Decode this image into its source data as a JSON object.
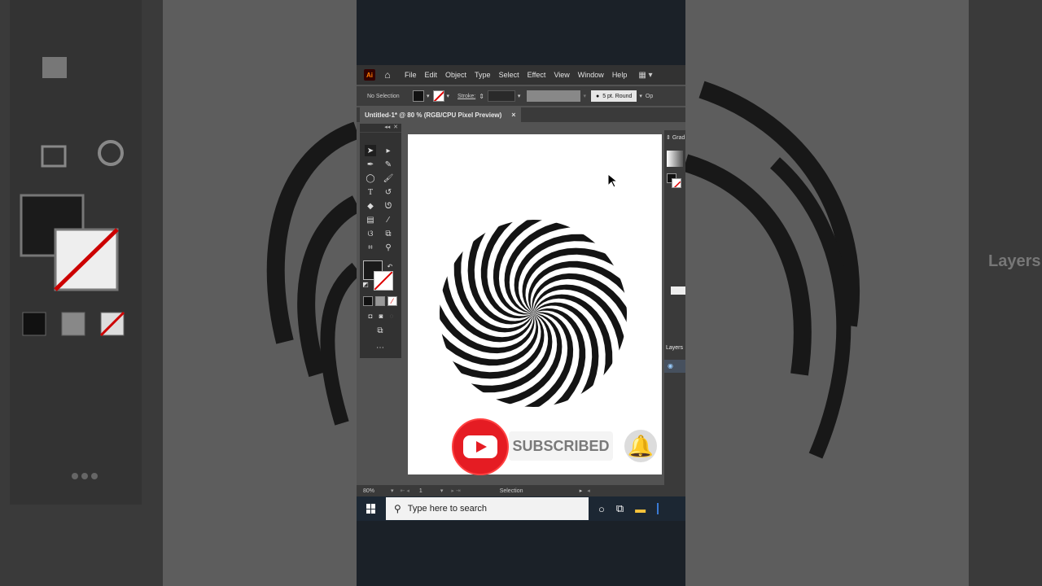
{
  "menubar": {
    "app_logo": "Ai",
    "home_icon": "home-icon",
    "items": [
      "File",
      "Edit",
      "Object",
      "Type",
      "Select",
      "Effect",
      "View",
      "Window",
      "Help"
    ]
  },
  "controlbar": {
    "selection_label": "No Selection",
    "stroke_label": "Stroke:",
    "brush_label": "5 pt. Round",
    "opacity_label": "Op"
  },
  "tabbar": {
    "doc_title": "Untitled-1* @ 80 % (RGB/CPU Pixel Preview)",
    "close": "×"
  },
  "right_panel": {
    "gradient_label": "Grad",
    "layers_label": "Layers"
  },
  "statusbar": {
    "zoom": "80%",
    "artboard_number": "1",
    "tool_name": "Selection"
  },
  "taskbar": {
    "search_placeholder": "Type here to search"
  },
  "overlay": {
    "subscribed_text": "SUBSCRIBED"
  },
  "background": {
    "layers_text": "Layers"
  },
  "colors": {
    "accent_red": "#e51c23",
    "app_bg": "#535353",
    "panel_bg": "#323232"
  }
}
